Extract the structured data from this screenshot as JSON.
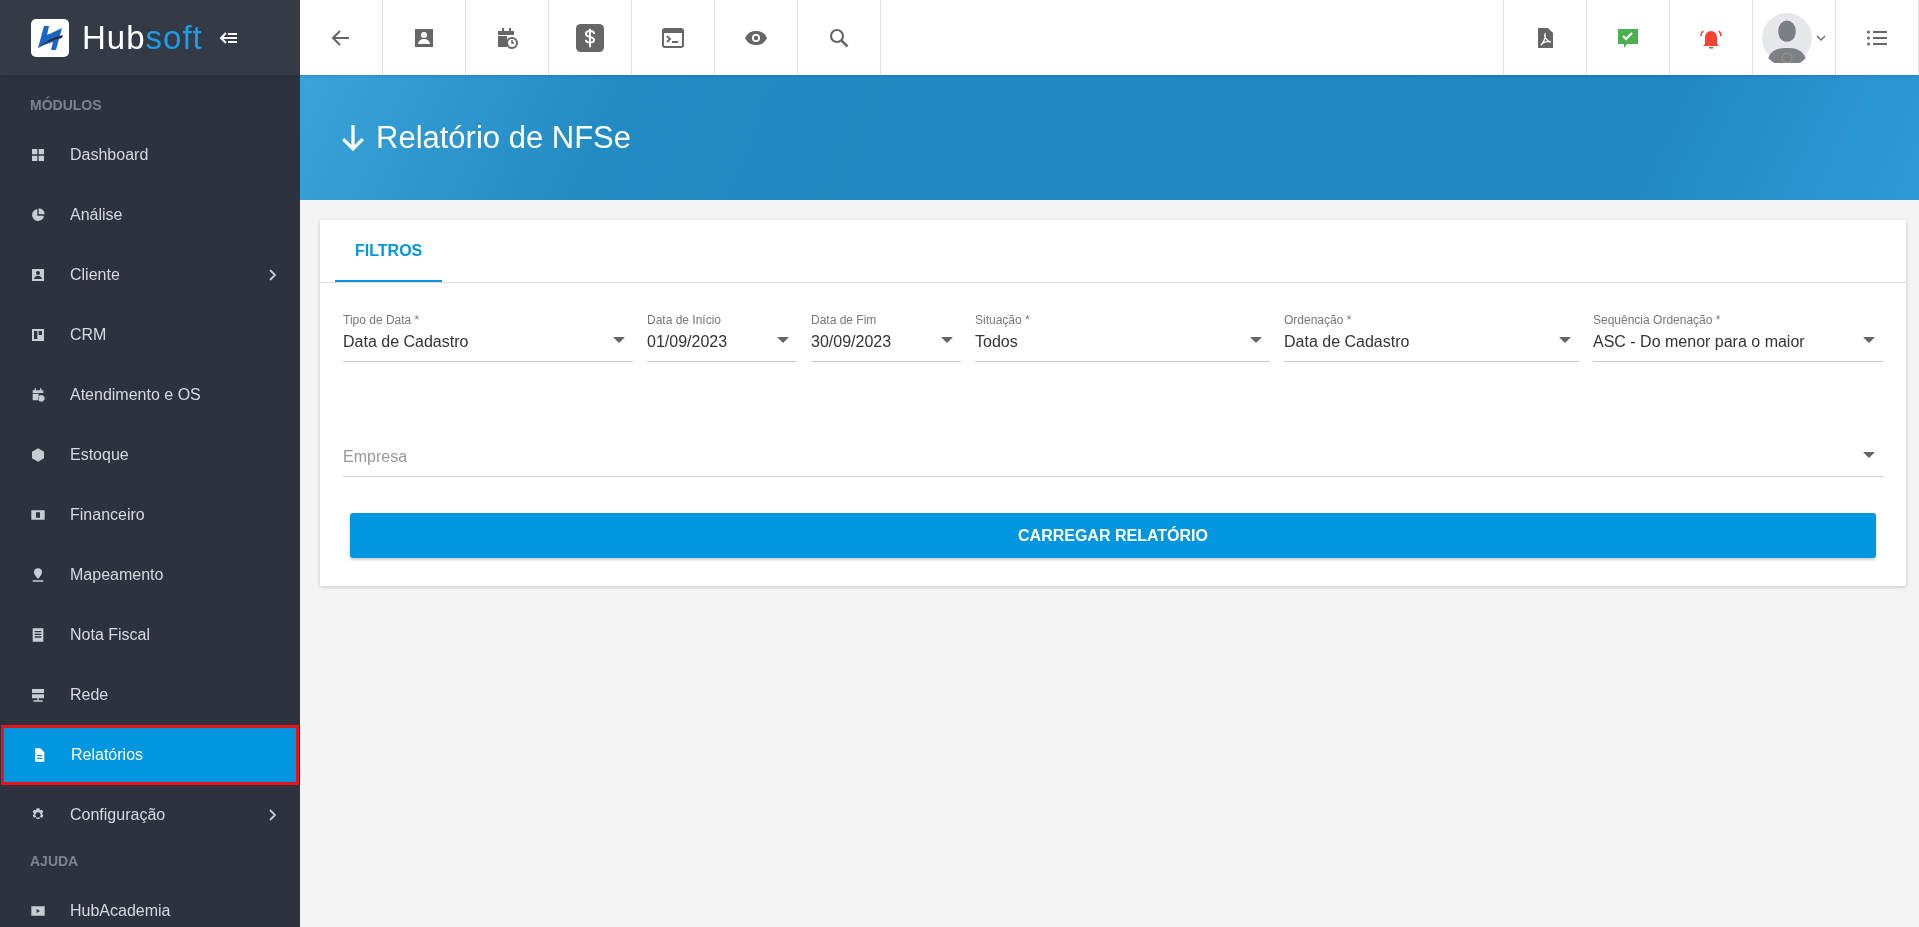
{
  "logo": {
    "text_main": "Hub",
    "text_accent": "soft"
  },
  "sidebar": {
    "sections": [
      {
        "title": "MÓDULOS",
        "items": [
          {
            "label": "Dashboard",
            "selected": false,
            "expandable": false
          },
          {
            "label": "Análise",
            "selected": false,
            "expandable": false
          },
          {
            "label": "Cliente",
            "selected": false,
            "expandable": true
          },
          {
            "label": "CRM",
            "selected": false,
            "expandable": false
          },
          {
            "label": "Atendimento e OS",
            "selected": false,
            "expandable": false
          },
          {
            "label": "Estoque",
            "selected": false,
            "expandable": false
          },
          {
            "label": "Financeiro",
            "selected": false,
            "expandable": false
          },
          {
            "label": "Mapeamento",
            "selected": false,
            "expandable": false
          },
          {
            "label": "Nota Fiscal",
            "selected": false,
            "expandable": false
          },
          {
            "label": "Rede",
            "selected": false,
            "expandable": false
          },
          {
            "label": "Relatórios",
            "selected": true,
            "expandable": false
          },
          {
            "label": "Configuração",
            "selected": false,
            "expandable": true
          }
        ]
      },
      {
        "title": "AJUDA",
        "items": [
          {
            "label": "HubAcademia",
            "selected": false,
            "expandable": false
          }
        ]
      }
    ]
  },
  "page": {
    "title": "Relatório de NFSe"
  },
  "tabs": [
    {
      "label": "FILTROS",
      "selected": true
    }
  ],
  "filters": [
    {
      "label": "Tipo de Data *",
      "value": "Data de Cadastro"
    },
    {
      "label": "Data de Início",
      "value": "01/09/2023"
    },
    {
      "label": "Data de Fim",
      "value": "30/09/2023"
    },
    {
      "label": "Situação *",
      "value": "Todos"
    },
    {
      "label": "Ordenação *",
      "value": "Data de Cadastro"
    },
    {
      "label": "Sequência Ordenação *",
      "value": "ASC - Do menor para o maior"
    }
  ],
  "empresa": {
    "placeholder": "Empresa"
  },
  "button": "CARREGAR RELATÓRIO"
}
